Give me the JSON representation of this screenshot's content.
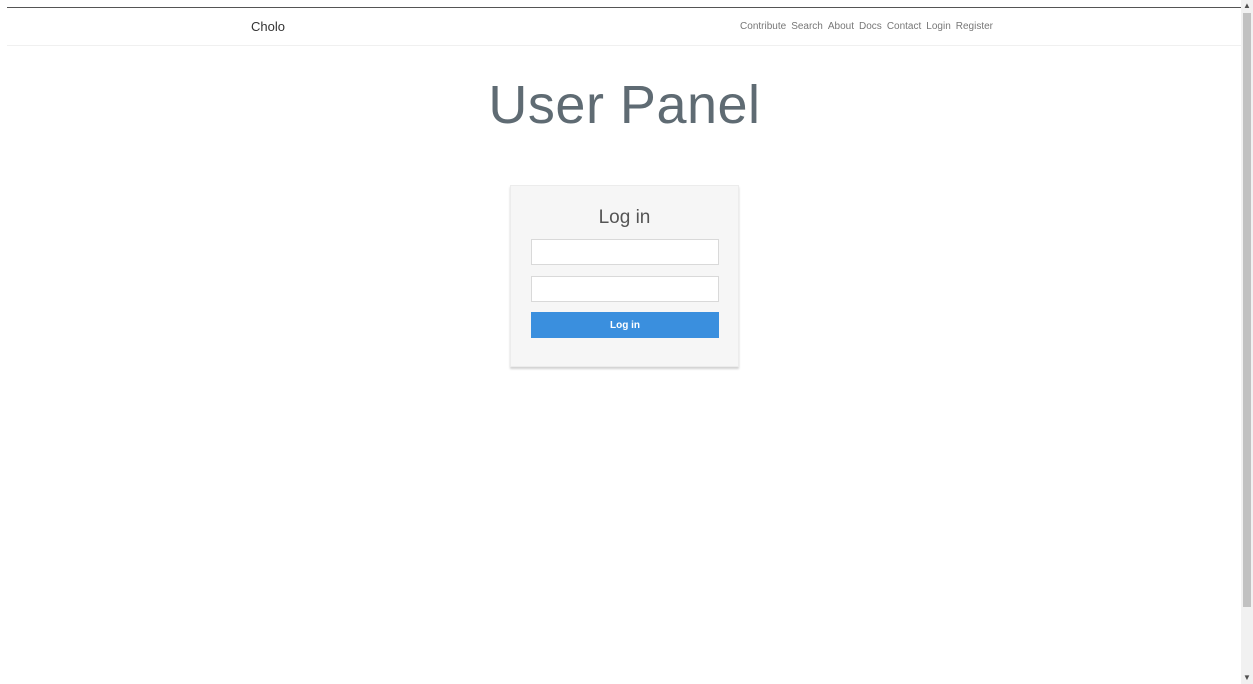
{
  "navbar": {
    "brand": "Cholo",
    "links": [
      {
        "label": "Contribute"
      },
      {
        "label": "Search"
      },
      {
        "label": "About"
      },
      {
        "label": "Docs"
      },
      {
        "label": "Contact"
      },
      {
        "label": "Login"
      },
      {
        "label": "Register"
      }
    ]
  },
  "main": {
    "title": "User Panel"
  },
  "login_form": {
    "title": "Log in",
    "username": {
      "value": "",
      "placeholder": ""
    },
    "password": {
      "value": "",
      "placeholder": ""
    },
    "submit_label": "Log in"
  },
  "scrollbar": {
    "up_icon": "chevron-up-icon",
    "down_icon": "chevron-down-icon"
  },
  "colors": {
    "primary_button": "#3a8fde",
    "title_text": "#5f6b73",
    "nav_link": "#777777",
    "card_background": "#f6f6f6"
  }
}
